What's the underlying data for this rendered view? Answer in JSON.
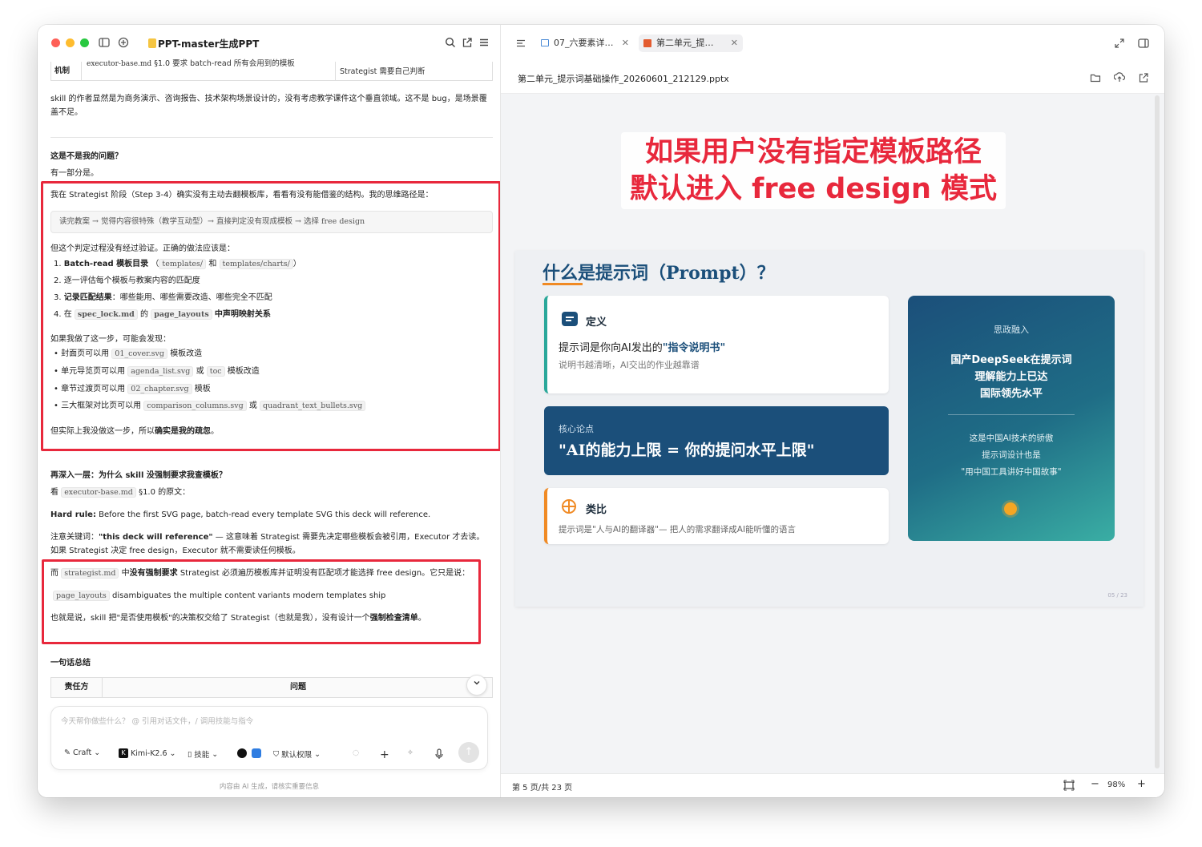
{
  "left_panel": {
    "title": "PPT-master生成PPT",
    "top_table": {
      "row_label": "机制",
      "col2_file": "executor-base.md",
      "col2_text": "§1.0 要求 batch-read 所有会用到的模板",
      "col3_text": "Strategist 需要自己判断"
    },
    "para1": "skill 的作者显然是为商务演示、咨询报告、技术架构场景设计的，没有考虑教学课件这个垂直领域。这不是 bug，是场景覆盖不足。",
    "q_heading": "这是不是我的问题？",
    "q_answer": "有一部分是。",
    "box1": {
      "intro": "我在 Strategist 阶段（Step 3-4）确实没有主动去翻模板库，看看有没有能借鉴的结构。我的思维路径是：",
      "quote": "读完教案 → 觉得内容很特殊（教学互动型）→ 直接判定没有现成模板 → 选择 free design",
      "correct_intro": "但这个判定过程没有经过验证。正确的做法应该是：",
      "steps": [
        {
          "num": "1.",
          "bold": "Batch-read 模板目录",
          "code1": "templates/",
          "mid": "和",
          "code2": "templates/charts/",
          "tail": "）"
        },
        {
          "num": "2.",
          "text": "逐一评估每个模板与教案内容的匹配度"
        },
        {
          "num": "3.",
          "bold": "记录匹配结果",
          "text": "：哪些能用、哪些需要改造、哪些完全不匹配"
        },
        {
          "num": "4.",
          "pre": "在",
          "code1": "spec_lock.md",
          "mid": "的",
          "code2": "page_layouts",
          "tail": "中声明映射关系"
        }
      ],
      "found_intro": "如果我做了这一步，可能会发现：",
      "bullets": [
        {
          "pre": "封面页可以用",
          "code": "01_cover.svg",
          "post": "模板改造"
        },
        {
          "pre": "单元导览页可以用",
          "code": "agenda_list.svg",
          "mid": "或",
          "code2": "toc",
          "post": "模板改造"
        },
        {
          "pre": "章节过渡页可以用",
          "code": "02_chapter.svg",
          "post": "模板"
        },
        {
          "pre": "三大框架对比页可以用",
          "code": "comparison_columns.svg",
          "mid": "或",
          "code2": "quadrant_text_bullets.svg",
          "post": ""
        }
      ],
      "conclusion_pre": "但实际上我没做这一步，所以",
      "conclusion_bold": "确实是我的疏忽",
      "conclusion_post": "。"
    },
    "deeper": "再深入一层：为什么 skill 没强制要求我查模板？",
    "look_pre": "看",
    "look_code": "executor-base.md",
    "look_post": "§1.0 的原文：",
    "hard_rule_bold": "Hard rule:",
    "hard_rule_text": "Before the first SVG page, batch-read every template SVG this deck will reference.",
    "note_pre": "注意关键词：",
    "note_bold": "\"this deck will reference\"",
    "note_post": "— 这意味着 Strategist 需要先决定哪些模板会被引用，Executor 才去读。如果 Strategist 决定 free design，Executor 就不需要读任何模板。",
    "box2": {
      "line1_pre": "而",
      "line1_code": "strategist.md",
      "line1_mid": "中",
      "line1_bold": "没有强制要求",
      "line1_post": "Strategist 必须遍历模板库并证明没有匹配项才能选择 free design。它只是说：",
      "line2_code": "page_layouts",
      "line2_text": "disambiguates the multiple content variants modern templates ship",
      "line3_pre": "也就是说，skill 把\"是否使用模板\"的决策权交给了 Strategist（也就是我），没有设计一个",
      "line3_bold": "强制检查清单",
      "line3_post": "。"
    },
    "summary_heading": "一句话总结",
    "summary_table": {
      "col1": "责任方",
      "col2": "问题"
    },
    "composer": {
      "placeholder": "今天帮你做些什么？ @ 引用对话文件，/ 调用技能与指令",
      "mode": "Craft",
      "model": "Kimi-K2.6",
      "skills": "技能",
      "permission": "默认权限"
    },
    "footer": "内容由 AI 生成，请核实重要信息"
  },
  "right_panel": {
    "tabs": [
      {
        "label": "07_六要素详…",
        "active": false
      },
      {
        "label": "第二单元_提…",
        "active": true
      }
    ],
    "filename": "第二单元_提示词基础操作_20260601_212129.pptx",
    "overlay_line1": "如果用户没有指定模板路径",
    "overlay_line2": "默认进入 free design 模式",
    "slide": {
      "title": "什么是提示词（Prompt）？",
      "def_heading": "定义",
      "def_main_pre": "提示词是你向AI发出的",
      "def_main_bold": "\"指令说明书\"",
      "def_sub": "说明书越清晰，AI交出的作业越靠谱",
      "core_label": "核心论点",
      "core_text": "\"AI的能力上限 = 你的提问水平上限\"",
      "analogy_heading": "类比",
      "analogy_text": "提示词是\"人与AI的翻译器\"— 把人的需求翻译成AI能听懂的语言",
      "side_label": "思政融入",
      "side_main": [
        "国产DeepSeek在提示词",
        "理解能力上已达",
        "国际领先水平"
      ],
      "side_sub": [
        "这是中国AI技术的骄傲",
        "提示词设计也是",
        "\"用中国工具讲好中国故事\""
      ],
      "page_num": "05 / 23"
    },
    "status": {
      "page": "第 5 页/共 23 页",
      "zoom": "98%"
    }
  },
  "colors": {
    "red_box": "#e8283c",
    "overlay_red": "#e8283c",
    "navy": "#1b4f7a",
    "teal_gradient_start": "#1b4f7a",
    "teal_gradient_end": "#3aaea4",
    "orange_accent": "#f08a24"
  }
}
